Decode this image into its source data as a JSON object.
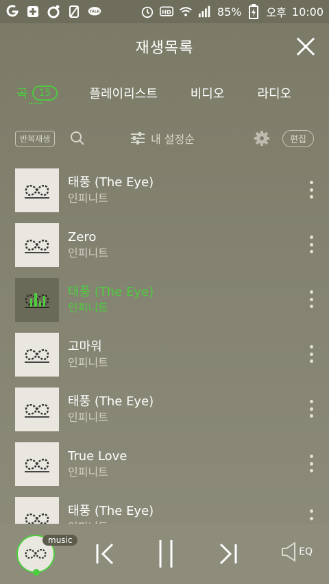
{
  "status_bar": {
    "battery": "85%",
    "ampm": "오후",
    "time": "10:00",
    "icons": [
      "notification-o-icon",
      "plus-box-icon",
      "record-icon",
      "no-sim-icon",
      "talk-icon",
      "alarm-icon",
      "hd-icon",
      "wifi-icon",
      "signal-icon",
      "battery-charging-icon"
    ]
  },
  "header": {
    "title": "재생목록",
    "close_icon": "close-icon"
  },
  "tabs": [
    {
      "label": "곡",
      "count": "15",
      "active": true
    },
    {
      "label": "플레이리스트"
    },
    {
      "label": "비디오"
    },
    {
      "label": "라디오"
    }
  ],
  "toolbar": {
    "repeat_label": "반복재생",
    "sort_label": "내 설정순",
    "edit_label": "편집"
  },
  "songs": [
    {
      "title": "태풍 (The Eye)",
      "artist": "인피니트"
    },
    {
      "title": "Zero",
      "artist": "인피니트"
    },
    {
      "title": "태풍 (The Eye)",
      "artist": "인피니트",
      "playing": true
    },
    {
      "title": "고마워",
      "artist": "인피니트"
    },
    {
      "title": "태풍 (The Eye)",
      "artist": "인피니트"
    },
    {
      "title": "True Love",
      "artist": "인피니트"
    },
    {
      "title": "태풍 (The Eye)",
      "artist": "인피니트"
    }
  ],
  "player": {
    "badge": "music",
    "eq_label": "EQ"
  },
  "colors": {
    "accent": "#4dcc3e",
    "background": "#838270"
  }
}
